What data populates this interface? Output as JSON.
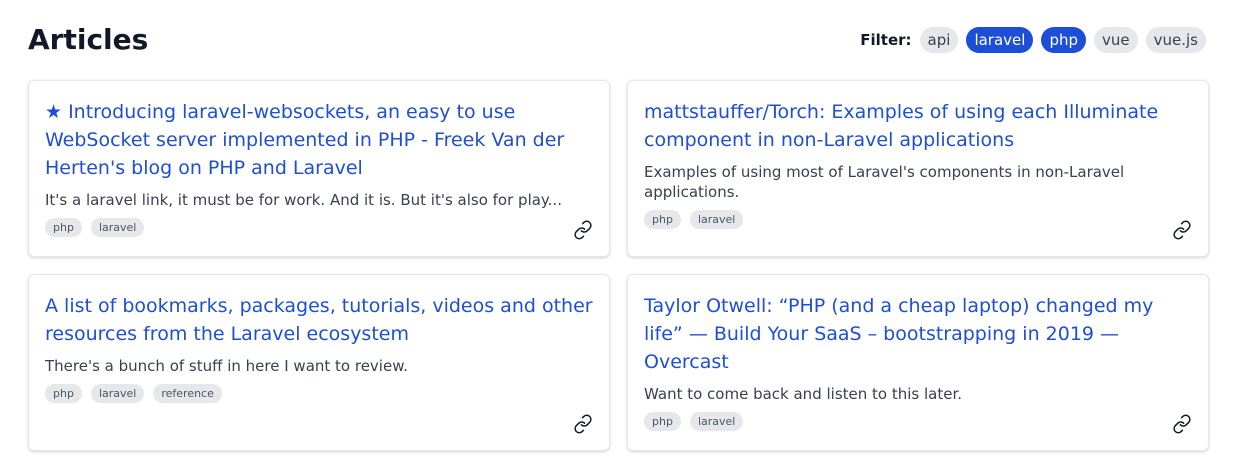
{
  "header": {
    "title": "Articles",
    "filter_label": "Filter:",
    "filters": [
      {
        "label": "api",
        "active": false
      },
      {
        "label": "laravel",
        "active": true
      },
      {
        "label": "php",
        "active": true
      },
      {
        "label": "vue",
        "active": false
      },
      {
        "label": "vue.js",
        "active": false
      }
    ]
  },
  "articles": [
    {
      "title": "★ Introducing laravel-websockets, an easy to use WebSocket server implemented in PHP - Freek Van der Herten's blog on PHP and Laravel",
      "description": "It's a laravel link, it must be for work. And it is. But it's also for play...",
      "tags": [
        "php",
        "laravel"
      ]
    },
    {
      "title": "mattstauffer/Torch: Examples of using each Illuminate component in non-Laravel applications",
      "description": "Examples of using most of Laravel's components in non-Laravel applications.",
      "tags": [
        "php",
        "laravel"
      ]
    },
    {
      "title": "A list of bookmarks, packages, tutorials, videos and other resources from the Laravel ecosystem",
      "description": "There's a bunch of stuff in here I want to review.",
      "tags": [
        "php",
        "laravel",
        "reference"
      ]
    },
    {
      "title": "Taylor Otwell: “PHP (and a cheap laptop) changed my life” — Build Your SaaS – bootstrapping in 2019 — Overcast",
      "description": "Want to come back and listen to this later.",
      "tags": [
        "php",
        "laravel"
      ]
    }
  ],
  "colors": {
    "accent": "#1d4ed8",
    "pill_bg": "#e5e7eb"
  },
  "icons": {
    "card_link": "link-icon"
  }
}
